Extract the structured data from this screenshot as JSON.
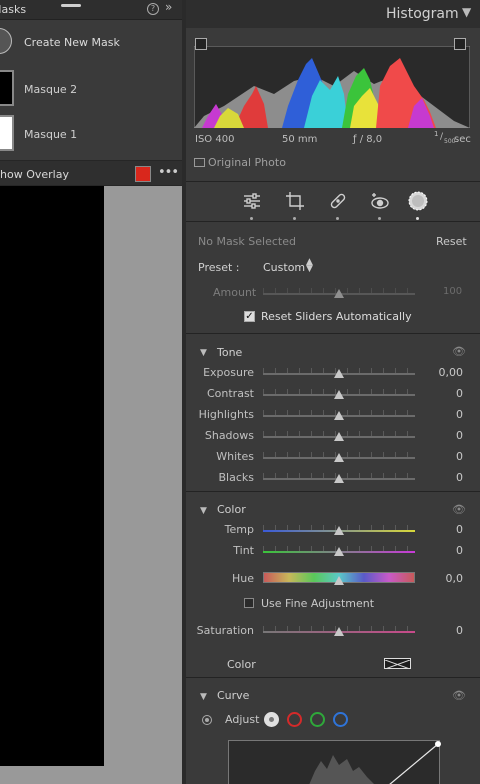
{
  "masks": {
    "title": "Masks",
    "help_icon": "help-icon",
    "help_glyph": "?",
    "collapse_glyph": "»",
    "create_label": "Create New Mask",
    "items": [
      {
        "label": "Masque 2",
        "thumb_color": "#000000"
      },
      {
        "label": "Masque 1",
        "thumb_color": "#ffffff"
      }
    ],
    "overlay_label": "how Overlay",
    "overlay_color": "#d9271c",
    "more_glyph": "•••"
  },
  "histogram": {
    "title": "Histogram",
    "collapse_glyph": "▼",
    "iso": "ISO 400",
    "focal": "50 mm",
    "aperture": "ƒ / 8,0",
    "shutter_num": "1",
    "shutter_den": "500",
    "shutter_unit": "sec",
    "original_photo_label": "Original Photo"
  },
  "tools": [
    "edit-sliders-icon",
    "crop-icon",
    "healing-icon",
    "red-eye-icon",
    "masking-icon"
  ],
  "mask_panel": {
    "no_mask": "No Mask Selected",
    "reset": "Reset",
    "preset_label": "Preset :",
    "preset_value": "Custom",
    "amount_label": "Amount",
    "amount_value": "100",
    "amount_level": 0.5,
    "reset_sliders_label": "Reset Sliders Automatically",
    "reset_sliders_checked": true,
    "check_glyph": "✓"
  },
  "tone": {
    "title": "Tone",
    "triangle_glyph": "▼",
    "eye_glyph": "👁",
    "sliders": [
      {
        "label": "Exposure",
        "value": "0,00",
        "level": 0.5
      },
      {
        "label": "Contrast",
        "value": "0",
        "level": 0.5
      },
      {
        "label": "Highlights",
        "value": "0",
        "level": 0.5
      },
      {
        "label": "Shadows",
        "value": "0",
        "level": 0.5
      },
      {
        "label": "Whites",
        "value": "0",
        "level": 0.5
      },
      {
        "label": "Blacks",
        "value": "0",
        "level": 0.5
      }
    ]
  },
  "color": {
    "title": "Color",
    "triangle_glyph": "▼",
    "eye_glyph": "👁",
    "temp_label": "Temp",
    "temp_value": "0",
    "temp_level": 0.5,
    "tint_label": "Tint",
    "tint_value": "0",
    "tint_level": 0.5,
    "hue_label": "Hue",
    "hue_value": "0,0",
    "hue_level": 0.5,
    "fine_label": "Use Fine Adjustment",
    "saturation_label": "Saturation",
    "saturation_value": "0",
    "saturation_level": 0.5,
    "color_label": "Color"
  },
  "curve": {
    "title": "Curve",
    "triangle_glyph": "▼",
    "eye_glyph": "👁",
    "adjust_label": "Adjust",
    "channels": [
      {
        "name": "rgb",
        "color": "#e0e0e0"
      },
      {
        "name": "red",
        "color": "#d42a2a"
      },
      {
        "name": "green",
        "color": "#2fa83a"
      },
      {
        "name": "blue",
        "color": "#2f74d8"
      }
    ]
  }
}
